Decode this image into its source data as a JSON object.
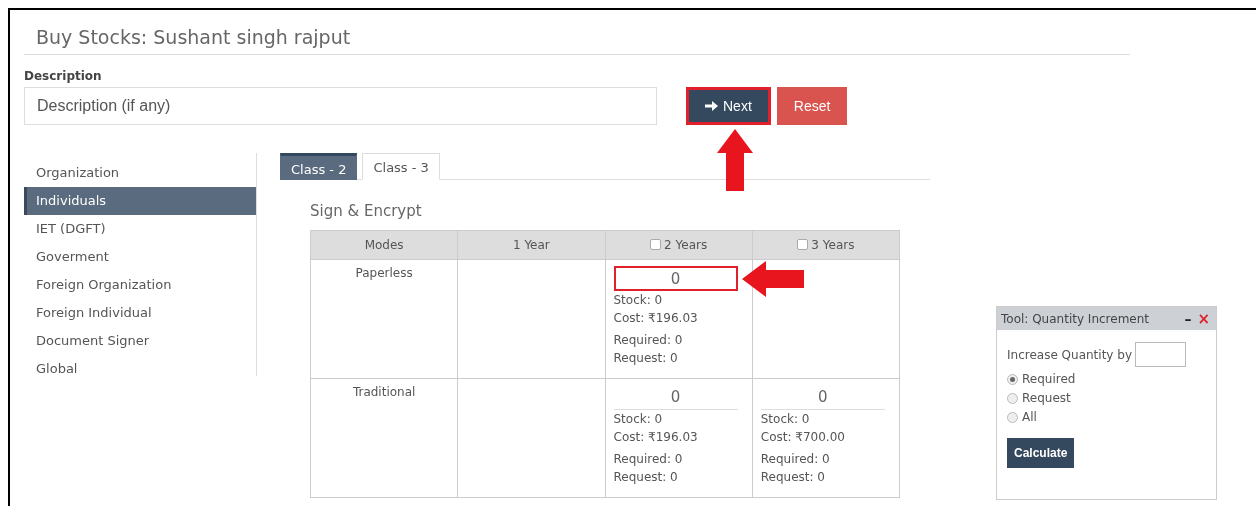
{
  "page_title": "Buy Stocks: Sushant singh rajput",
  "description": {
    "label": "Description",
    "placeholder": "Description (if any)"
  },
  "buttons": [
    {
      "label": "Next",
      "kind": "primary",
      "highlighted": true
    },
    {
      "label": "Reset",
      "kind": "danger",
      "highlighted": false
    }
  ],
  "sidebar": {
    "items": [
      {
        "label": "Organization",
        "selected": false
      },
      {
        "label": "Individuals",
        "selected": true
      },
      {
        "label": "IET (DGFT)",
        "selected": false
      },
      {
        "label": "Goverment",
        "selected": false
      },
      {
        "label": "Foreign Organization",
        "selected": false
      },
      {
        "label": "Foreign Individual",
        "selected": false
      },
      {
        "label": "Document Signer",
        "selected": false
      },
      {
        "label": "Global",
        "selected": false
      }
    ]
  },
  "tabs": [
    {
      "label": "Class - 2",
      "selected": true
    },
    {
      "label": "Class - 3",
      "selected": false
    }
  ],
  "section_title": "Sign & Encrypt",
  "table": {
    "columns": [
      {
        "label": "Modes",
        "kind": "text"
      },
      {
        "label": "1 Year",
        "kind": "text"
      },
      {
        "label": "2 Years",
        "kind": "checkbox",
        "checked": false
      },
      {
        "label": "3 Years",
        "kind": "checkbox",
        "checked": false
      }
    ],
    "rows": [
      {
        "cells": [
          {
            "kind": "mode",
            "text": "Paperless"
          },
          {
            "kind": "empty"
          },
          {
            "kind": "stock",
            "quantity": "0",
            "highlighted": true,
            "stock": "Stock: 0",
            "cost": "Cost: ₹196.03",
            "required": "Required: 0",
            "request": "Request: 0"
          },
          {
            "kind": "empty"
          }
        ]
      },
      {
        "cells": [
          {
            "kind": "mode",
            "text": "Traditional"
          },
          {
            "kind": "empty"
          },
          {
            "kind": "stock",
            "quantity": "0",
            "highlighted": false,
            "stock": "Stock: 0",
            "cost": "Cost: ₹196.03",
            "required": "Required: 0",
            "request": "Request: 0"
          },
          {
            "kind": "stock",
            "quantity": "0",
            "highlighted": false,
            "stock": "Stock: 0",
            "cost": "Cost: ₹700.00",
            "required": "Required: 0",
            "request": "Request: 0"
          }
        ]
      }
    ]
  },
  "tool": {
    "title": "Tool: Quantity Increment",
    "minimize": "–",
    "close": "×",
    "increase_label": "Increase Quantity by",
    "options": [
      {
        "label": "Required",
        "selected": true
      },
      {
        "label": "Request",
        "selected": false
      },
      {
        "label": "All",
        "selected": false
      }
    ],
    "button": "Calculate"
  }
}
